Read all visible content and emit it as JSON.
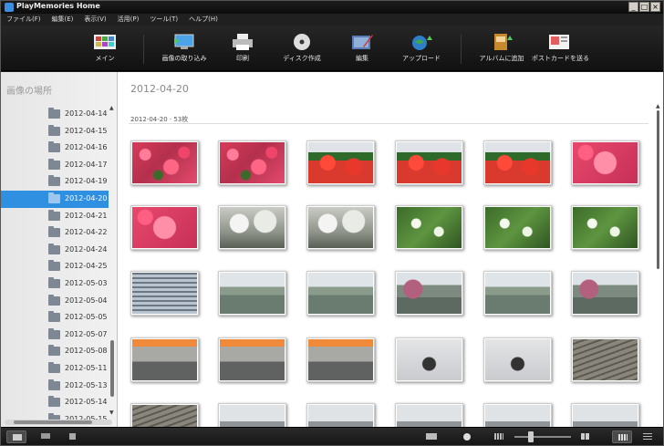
{
  "window": {
    "title": "PlayMemories Home",
    "controls": [
      "_",
      "□",
      "×"
    ]
  },
  "menubar": [
    "ファイル(F)",
    "編集(E)",
    "表示(V)",
    "活用(P)",
    "ツール(T)",
    "ヘルプ(H)"
  ],
  "toolbar": [
    {
      "label": "メイン",
      "icon": "main-icon"
    },
    {
      "label": "画像の取り込み",
      "icon": "import-icon"
    },
    {
      "label": "印刷",
      "icon": "print-icon"
    },
    {
      "label": "ディスク作成",
      "icon": "disc-icon"
    },
    {
      "label": "編集",
      "icon": "edit-icon"
    },
    {
      "label": "アップロード",
      "icon": "upload-icon"
    },
    {
      "label": "アルバムに追加",
      "icon": "album-icon"
    },
    {
      "label": "ポストカードを送る",
      "icon": "postcard-icon"
    }
  ],
  "sidebar": {
    "header": "画像の場所",
    "folders": [
      "2012-04-14",
      "2012-04-15",
      "2012-04-16",
      "2012-04-17",
      "2012-04-19",
      "2012-04-20",
      "2012-04-21",
      "2012-04-22",
      "2012-04-24",
      "2012-04-25",
      "2012-05-03",
      "2012-05-04",
      "2012-05-05",
      "2012-05-07",
      "2012-05-08",
      "2012-05-11",
      "2012-05-13",
      "2012-05-14",
      "2012-05-15"
    ],
    "selected": "2012-04-20"
  },
  "content": {
    "date_title": "2012-04-20",
    "group_label": "2012-04-20  ·  53枚"
  },
  "thumbnails": [
    [
      "p-flower",
      "p-flower",
      "p-red",
      "p-red",
      "p-red",
      "p-pinkbig"
    ],
    [
      "p-pinkbig",
      "p-tree",
      "p-tree",
      "p-green",
      "p-green",
      "p-green"
    ],
    [
      "p-stairs",
      "p-canal",
      "p-canal",
      "p-canal-pink",
      "p-canal",
      "p-canal-pink"
    ],
    [
      "p-bridge",
      "p-bridge",
      "p-bridge",
      "p-lamp",
      "p-lamp",
      "p-bench"
    ],
    [
      "p-bench",
      "p-building",
      "p-building",
      "p-building",
      "p-building",
      "p-building"
    ]
  ],
  "status": {
    "accent": "#2f8fe0"
  }
}
